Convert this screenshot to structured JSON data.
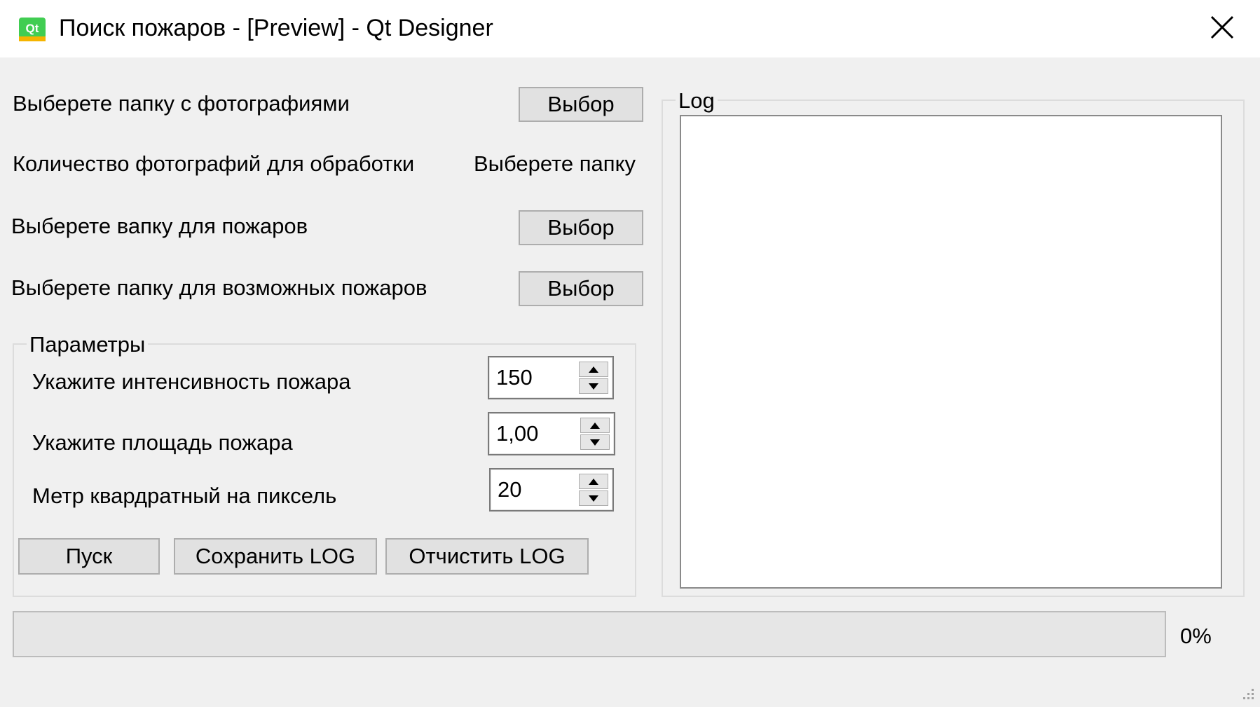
{
  "window": {
    "title": "Поиск пожаров - [Preview] - Qt Designer",
    "icon": "qt-icon"
  },
  "rows": {
    "photos_folder_label": "Выберете папку с фотографиями",
    "photos_count_label": "Количество фотографий для обработки",
    "photos_count_value": "Выберете папку",
    "fires_folder_label": "Выберете вапку для пожаров",
    "possible_fires_folder_label": "Выберете папку для возможных пожаров",
    "choose_button_label": "Выбор"
  },
  "params": {
    "title": "Параметры",
    "intensity_label": "Укажите интенсивность пожара",
    "intensity_value": "150",
    "area_label": "Укажите площадь пожара",
    "area_value": "1,00",
    "meter_label": "Метр квардратный на пиксель",
    "meter_value": "20"
  },
  "actions": {
    "start_label": "Пуск",
    "save_log_label": "Сохранить LOG",
    "clear_log_label": "Отчистить LOG"
  },
  "log": {
    "title": "Log",
    "content": ""
  },
  "progress": {
    "value": 0,
    "text": "0%"
  },
  "colors": {
    "window_bg": "#f0f0f0",
    "button_bg": "#e1e1e1",
    "progress_fill": "#06b025"
  }
}
